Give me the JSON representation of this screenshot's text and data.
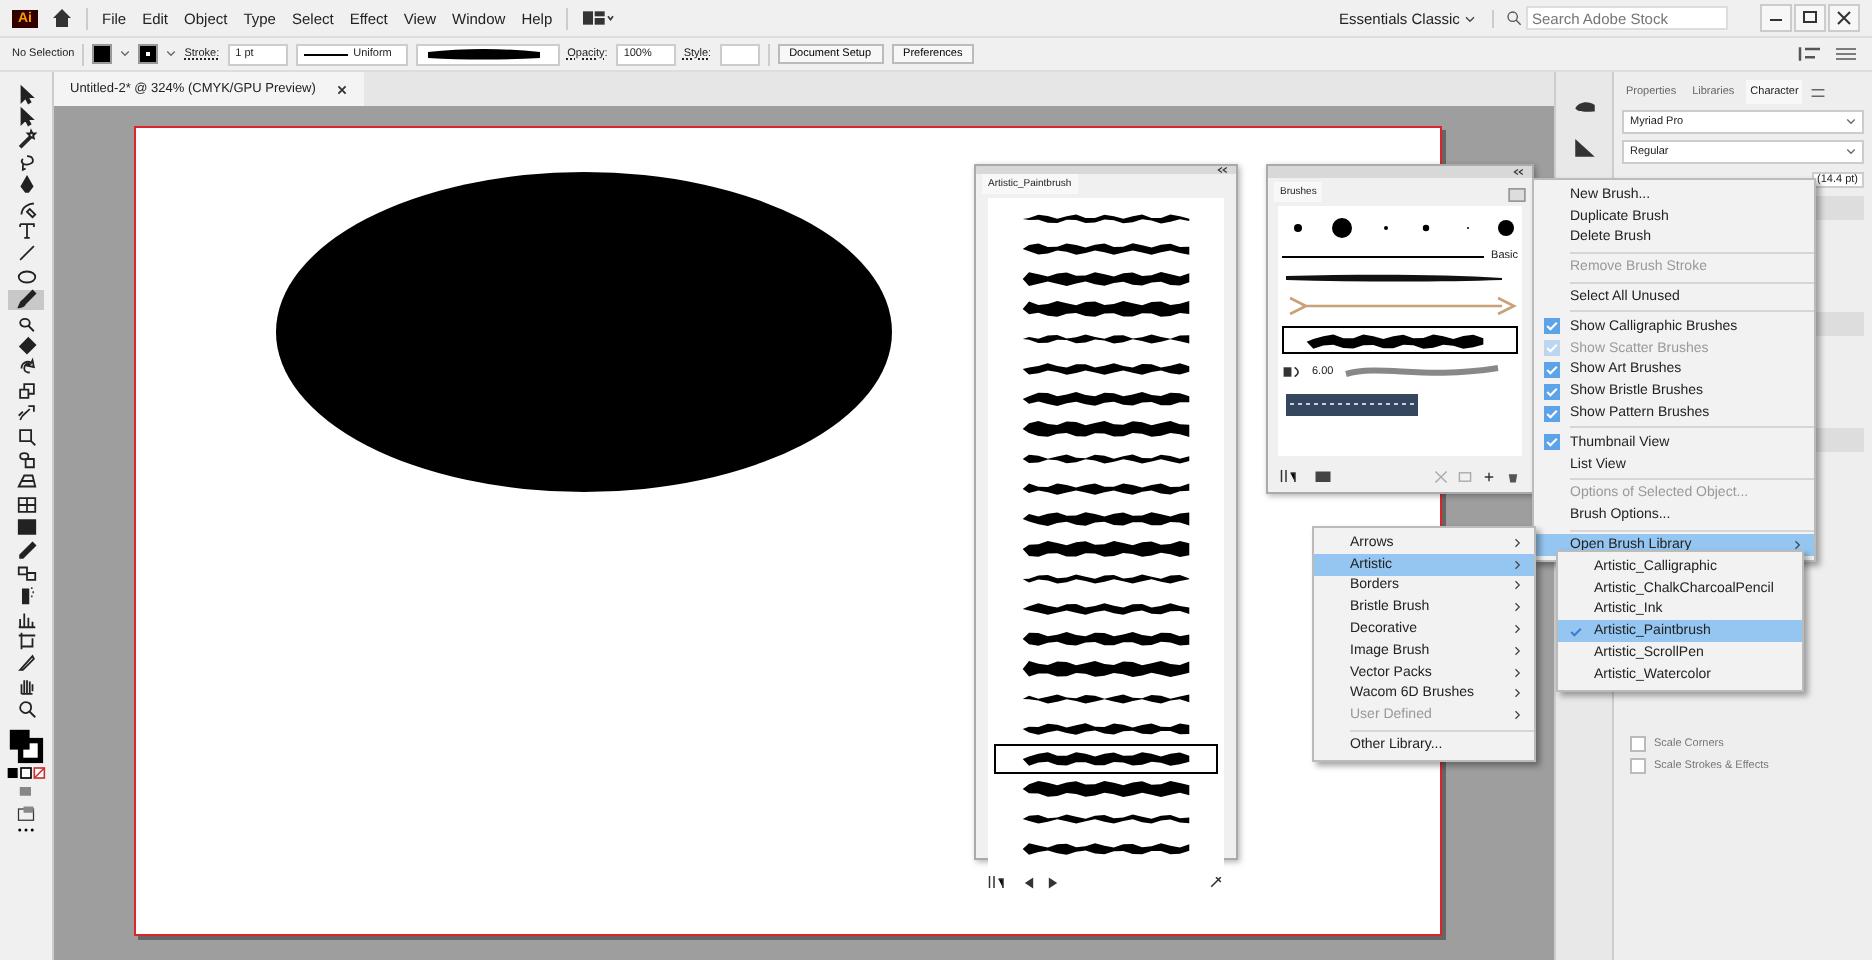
{
  "app_bar": {
    "logo": "Ai",
    "menus": [
      "File",
      "Edit",
      "Object",
      "Type",
      "Select",
      "Effect",
      "View",
      "Window",
      "Help"
    ],
    "workspace": "Essentials Classic",
    "search": {
      "placeholder": "Search Adobe Stock"
    }
  },
  "control_bar": {
    "selection": "No Selection",
    "stroke_label": "Stroke:",
    "stroke_weight": "1 pt",
    "profile": "Uniform",
    "opacity_label": "Opacity:",
    "opacity": "100%",
    "style_label": "Style:",
    "buttons": [
      "Document Setup",
      "Preferences"
    ]
  },
  "document_tab": {
    "title": "Untitled-2* @ 324% (CMYK/GPU Preview)"
  },
  "tools": [
    {
      "kind": "selection",
      "selected": false
    },
    {
      "kind": "direct",
      "selected": false
    },
    {
      "kind": "wand",
      "selected": false
    },
    {
      "kind": "lasso",
      "selected": false
    },
    {
      "kind": "pen",
      "selected": false
    },
    {
      "kind": "curvature",
      "selected": false
    },
    {
      "kind": "type",
      "selected": false
    },
    {
      "kind": "line",
      "selected": false
    },
    {
      "kind": "ellipse",
      "selected": false
    },
    {
      "kind": "brush",
      "selected": true
    },
    {
      "kind": "shaper",
      "selected": false
    },
    {
      "kind": "eraser",
      "selected": false
    },
    {
      "kind": "rotate",
      "selected": false
    },
    {
      "kind": "scale",
      "selected": false
    },
    {
      "kind": "width",
      "selected": false
    },
    {
      "kind": "transform",
      "selected": false
    },
    {
      "kind": "builder",
      "selected": false
    },
    {
      "kind": "perspective",
      "selected": false
    },
    {
      "kind": "mesh",
      "selected": false
    },
    {
      "kind": "gradient",
      "selected": false
    },
    {
      "kind": "eyedropper",
      "selected": false
    },
    {
      "kind": "blend",
      "selected": false
    },
    {
      "kind": "sprayer",
      "selected": false
    },
    {
      "kind": "graph",
      "selected": false
    },
    {
      "kind": "artboard",
      "selected": false
    },
    {
      "kind": "slice",
      "selected": false
    },
    {
      "kind": "hand",
      "selected": false
    },
    {
      "kind": "zoom",
      "selected": false
    }
  ],
  "library_panel": {
    "tab": "Artistic_Paintbrush",
    "brushes": [
      {
        "selected": false
      },
      {
        "selected": false
      },
      {
        "selected": false
      },
      {
        "selected": false
      },
      {
        "selected": false
      },
      {
        "selected": false
      },
      {
        "selected": false
      },
      {
        "selected": false
      },
      {
        "selected": false
      },
      {
        "selected": false
      },
      {
        "selected": false
      },
      {
        "selected": false
      },
      {
        "selected": false
      },
      {
        "selected": false
      },
      {
        "selected": false
      },
      {
        "selected": false
      },
      {
        "selected": false
      },
      {
        "selected": false
      },
      {
        "selected": true
      },
      {
        "selected": false
      },
      {
        "selected": false
      },
      {
        "selected": false
      }
    ]
  },
  "brushes_panel": {
    "tab": "Brushes",
    "basic_label": "Basic",
    "scatter_size": "6.00"
  },
  "flyout": {
    "items": [
      {
        "kind": "item",
        "label": "New Brush...",
        "checked": false,
        "disabled": false,
        "selected": false
      },
      {
        "kind": "item",
        "label": "Duplicate Brush",
        "checked": false,
        "disabled": false,
        "selected": false
      },
      {
        "kind": "item",
        "label": "Delete Brush",
        "checked": false,
        "disabled": false,
        "selected": false
      },
      {
        "kind": "separator"
      },
      {
        "kind": "item",
        "label": "Remove Brush Stroke",
        "checked": false,
        "disabled": true,
        "selected": false
      },
      {
        "kind": "separator"
      },
      {
        "kind": "item",
        "label": "Select All Unused",
        "checked": false,
        "disabled": false,
        "selected": false
      },
      {
        "kind": "separator"
      },
      {
        "kind": "item",
        "label": "Show Calligraphic Brushes",
        "checked": true,
        "disabled": false,
        "selected": false
      },
      {
        "kind": "item",
        "label": "Show Scatter Brushes",
        "checked": true,
        "disabled": true,
        "selected": false
      },
      {
        "kind": "item",
        "label": "Show Art Brushes",
        "checked": true,
        "disabled": false,
        "selected": false
      },
      {
        "kind": "item",
        "label": "Show Bristle Brushes",
        "checked": true,
        "disabled": false,
        "selected": false
      },
      {
        "kind": "item",
        "label": "Show Pattern Brushes",
        "checked": true,
        "disabled": false,
        "selected": false
      },
      {
        "kind": "separator"
      },
      {
        "kind": "item",
        "label": "Thumbnail View",
        "checked": true,
        "disabled": false,
        "selected": false
      },
      {
        "kind": "item",
        "label": "List View",
        "checked": false,
        "disabled": false,
        "selected": false
      },
      {
        "kind": "separator"
      },
      {
        "kind": "item",
        "label": "Options of Selected Object...",
        "checked": false,
        "disabled": true,
        "selected": false
      },
      {
        "kind": "item",
        "label": "Brush Options...",
        "checked": false,
        "disabled": false,
        "selected": false
      },
      {
        "kind": "separator"
      },
      {
        "kind": "submenu",
        "label": "Open Brush Library",
        "checked": false,
        "disabled": false,
        "selected": true
      }
    ]
  },
  "library_menu": {
    "items": [
      {
        "kind": "submenu",
        "label": "Arrows",
        "disabled": false,
        "selected": false
      },
      {
        "kind": "submenu",
        "label": "Artistic",
        "disabled": false,
        "selected": true
      },
      {
        "kind": "submenu",
        "label": "Borders",
        "disabled": false,
        "selected": false
      },
      {
        "kind": "submenu",
        "label": "Bristle Brush",
        "disabled": false,
        "selected": false
      },
      {
        "kind": "submenu",
        "label": "Decorative",
        "disabled": false,
        "selected": false
      },
      {
        "kind": "submenu",
        "label": "Image Brush",
        "disabled": false,
        "selected": false
      },
      {
        "kind": "submenu",
        "label": "Vector Packs",
        "disabled": false,
        "selected": false
      },
      {
        "kind": "submenu",
        "label": "Wacom 6D Brushes",
        "disabled": false,
        "selected": false
      },
      {
        "kind": "submenu",
        "label": "User Defined",
        "disabled": true,
        "selected": false
      },
      {
        "kind": "separator"
      },
      {
        "kind": "item",
        "label": "Other Library...",
        "disabled": false,
        "selected": false
      }
    ]
  },
  "artistic_menu": {
    "items": [
      {
        "label": "Artistic_Calligraphic",
        "checked": false,
        "selected": false
      },
      {
        "label": "Artistic_ChalkCharcoalPencil",
        "checked": false,
        "selected": false
      },
      {
        "label": "Artistic_Ink",
        "checked": false,
        "selected": false
      },
      {
        "label": "Artistic_Paintbrush",
        "checked": true,
        "selected": true
      },
      {
        "label": "Artistic_ScrollPen",
        "checked": false,
        "selected": false
      },
      {
        "label": "Artistic_Watercolor",
        "checked": false,
        "selected": false
      }
    ]
  },
  "right_panel": {
    "tabs": [
      {
        "label": "Properties",
        "selected": false
      },
      {
        "label": "Libraries",
        "selected": false
      },
      {
        "label": "Character",
        "selected": true
      }
    ],
    "font": "Myriad Pro",
    "style": "Regular",
    "leading": "(14.4 pt)",
    "checkboxes": [
      {
        "label": "Scale Corners",
        "checked": false
      },
      {
        "label": "Scale Strokes & Effects",
        "checked": false
      }
    ]
  }
}
